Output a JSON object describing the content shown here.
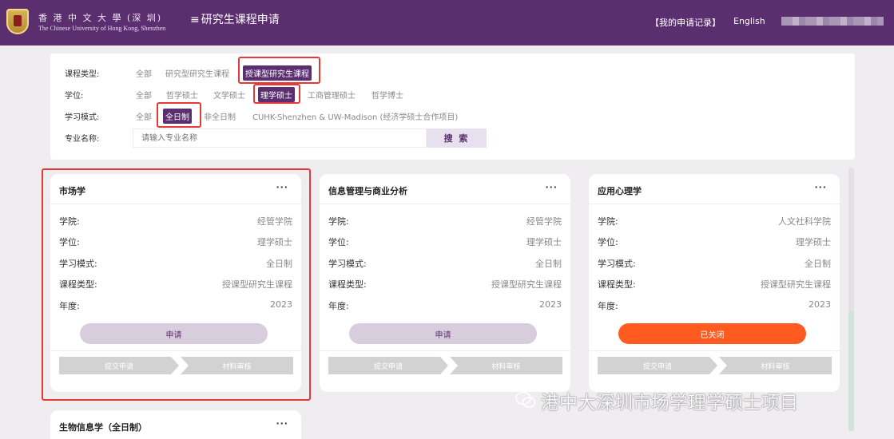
{
  "header": {
    "logo_cn": "香 港 中 文 大 學 (深 圳)",
    "logo_en": "The Chinese University of Hong Kong, Shenzhen",
    "menu_icon": "≡",
    "title": "研究生课程申请",
    "my_records": "【我的申请记录】",
    "language": "English"
  },
  "filters": {
    "course_type": {
      "label": "课程类型:",
      "options": [
        "全部",
        "研究型研究生课程",
        "授课型研究生课程"
      ],
      "selected": "授课型研究生课程"
    },
    "degree": {
      "label": "学位:",
      "options": [
        "全部",
        "哲学硕士",
        "文学硕士",
        "理学硕士",
        "工商管理硕士",
        "哲学博士"
      ],
      "selected": "理学硕士"
    },
    "study_mode": {
      "label": "学习模式:",
      "options": [
        "全部",
        "全日制",
        "非全日制",
        "CUHK-Shenzhen & UW-Madison (经济学硕士合作项目)"
      ],
      "selected": "全日制"
    },
    "program_name": {
      "label": "专业名称:",
      "placeholder": "请输入专业名称",
      "search_label": "搜 索"
    }
  },
  "field_labels": {
    "school": "学院:",
    "degree": "学位:",
    "mode": "学习模式:",
    "type": "课程类型:",
    "year": "年度:"
  },
  "cards": [
    {
      "title": "市场学",
      "more": "···",
      "school": "经管学院",
      "degree": "理学硕士",
      "mode": "全日制",
      "type": "授课型研究生课程",
      "year": "2023",
      "action": "申请",
      "status": "open",
      "steps": [
        "提交申请",
        "材料审核"
      ]
    },
    {
      "title": "信息管理与商业分析",
      "more": "···",
      "school": "经管学院",
      "degree": "理学硕士",
      "mode": "全日制",
      "type": "授课型研究生课程",
      "year": "2023",
      "action": "申请",
      "status": "open",
      "steps": [
        "提交申请",
        "材料审核"
      ]
    },
    {
      "title": "应用心理学",
      "more": "···",
      "school": "人文社科学院",
      "degree": "理学硕士",
      "mode": "全日制",
      "type": "授课型研究生课程",
      "year": "2023",
      "action": "已关闭",
      "status": "closed",
      "steps": [
        "提交申请",
        "材料审核"
      ]
    },
    {
      "title": "生物信息学（全日制）",
      "more": "···"
    }
  ],
  "watermark": "港中大深圳市场学理学硕士项目",
  "colors": {
    "brand_purple": "#5b2f6f",
    "highlight_red": "#e53935",
    "closed_orange": "#ff5a1f"
  }
}
